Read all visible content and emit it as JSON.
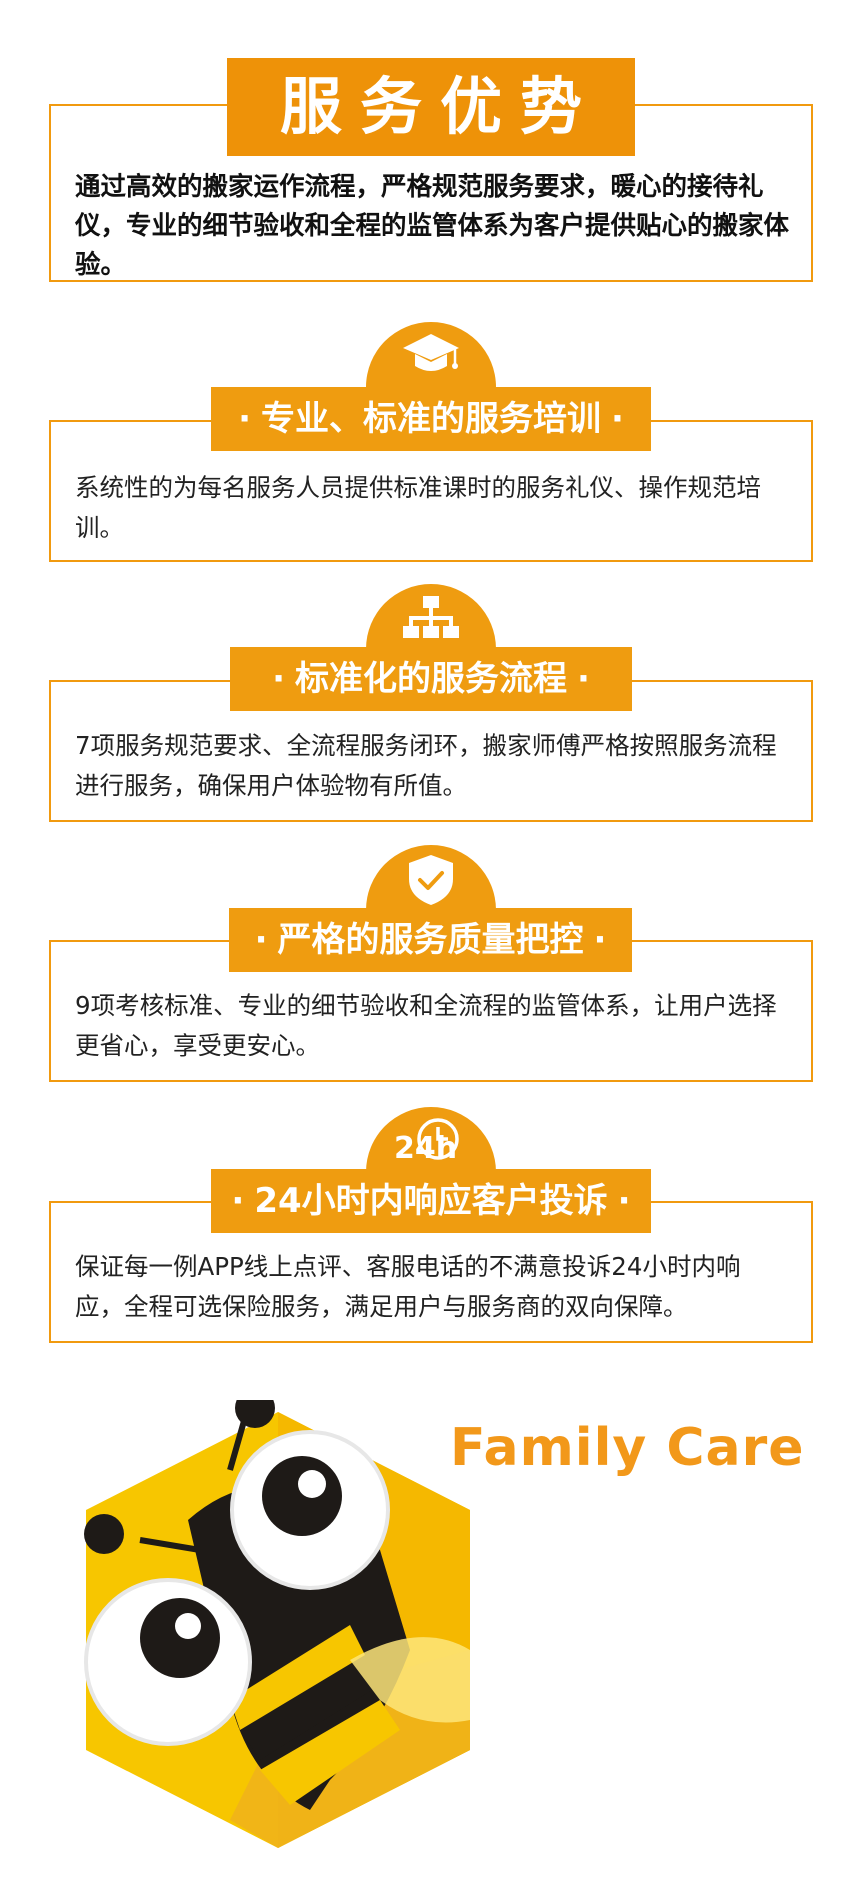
{
  "header": {
    "title": "服务优势",
    "intro": "通过高效的搬家运作流程，严格规范服务要求，暖心的接待礼仪，专业的细节验收和全程的监管体系为客户提供贴心的搬家体验。"
  },
  "sections": [
    {
      "icon": "graduation-cap-icon",
      "title": "专业、标准的服务培训",
      "body": "系统性的为每名服务人员提供标准课时的服务礼仪、操作规范培训。"
    },
    {
      "icon": "flowchart-icon",
      "title": "标准化的服务流程",
      "body": "7项服务规范要求、全流程服务闭环，搬家师傅严格按照服务流程进行服务，确保用户体验物有所值。"
    },
    {
      "icon": "shield-check-icon",
      "title": "严格的服务质量把控",
      "body": "9项考核标准、专业的细节验收和全流程的监管体系，让用户选择更省心，享受更安心。"
    },
    {
      "icon": "24h-clock-icon",
      "title": "24小时内响应客户投诉",
      "body": "保证每一例APP线上点评、客服电话的不满意投诉24小时内响应，全程可选保险服务，满足用户与服务商的双向保障。"
    }
  ],
  "icon_text": {
    "clock_24": "24h"
  },
  "brand": {
    "name": "Family Care",
    "color": "#f2981a"
  },
  "colors": {
    "accent": "#ef9c10",
    "border": "#f19a0f",
    "bee_yellow": "#f7c600",
    "bee_black": "#1e1a17"
  }
}
